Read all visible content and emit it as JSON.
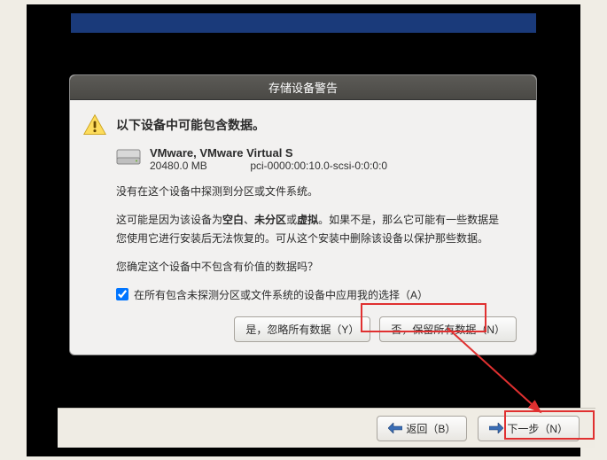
{
  "dialog": {
    "title": "存储设备警告",
    "header": "以下设备中可能包含数据。",
    "device": {
      "name": "VMware, VMware Virtual S",
      "size": "20480.0 MB",
      "path": "pci-0000:00:10.0-scsi-0:0:0:0"
    },
    "para1": "没有在这个设备中探测到分区或文件系统。",
    "para2_a": "这可能是因为该设备为",
    "para2_b": "空白",
    "para2_c": "、",
    "para2_d": "未分区",
    "para2_e": "或",
    "para2_f": "虚拟",
    "para2_g": "。如果不是，那么它可能有一些数据是您使用它进行安装后无法恢复的。可从这个安装中删除该设备以保护那些数据。",
    "para3": "您确定这个设备中不包含有价值的数据吗？",
    "checkbox_label": "在所有包含未探测分区或文件系统的设备中应用我的选择（A）",
    "btn_yes": "是，忽略所有数据（Y）",
    "btn_no": "否，保留所有数据（N）"
  },
  "nav": {
    "back": "返回（B）",
    "next": "下一步（N）"
  }
}
